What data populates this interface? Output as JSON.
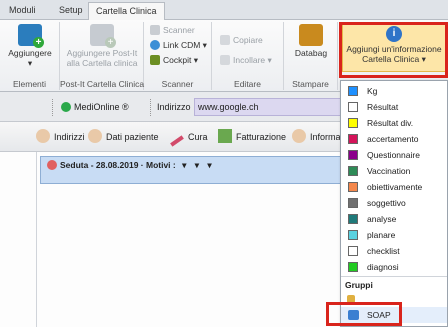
{
  "tabs": [
    "Moduli",
    "Setup",
    "Cartella Clinica"
  ],
  "ribbon": {
    "aggiungere_label": "Aggiungere",
    "aggiungere_postit_line1": "Aggiungere Post-It",
    "aggiungere_postit_line2": "alla Cartella clinica",
    "scanner": "Scanner",
    "link_cdm": "Link CDM",
    "cockpit": "Cockpit",
    "copiare": "Copiare",
    "incollare": "Incollare",
    "databag": "Databag",
    "aggiungi_info_line1": "Aggiungi un'informazione",
    "aggiungi_info_line2": "Cartella Clinica",
    "group_labels": [
      "Elementi",
      "Post-It Cartella Clinica",
      "Scanner",
      "Editare",
      "Stampare"
    ]
  },
  "address": {
    "medionline": "MediOnline ®",
    "label": "Indirizzo",
    "url": "www.google.ch"
  },
  "nav": [
    "Indirizzi",
    "Dati paziente",
    "Cura",
    "Fatturazione",
    "Informa"
  ],
  "seduta": {
    "text": "Seduta - 28.08.2019 · Motivi :"
  },
  "menu": {
    "items": [
      {
        "label": "Kg",
        "color": "#1e90ff"
      },
      {
        "label": "Résultat",
        "color": "#ffffff"
      },
      {
        "label": "Résultat div.",
        "color": "#ffff00"
      },
      {
        "label": "accertamento",
        "color": "#d4145a"
      },
      {
        "label": "Questionnaire",
        "color": "#8b008b"
      },
      {
        "label": "Vaccination",
        "color": "#2e8b57"
      },
      {
        "label": "obiettivamente",
        "color": "#f4874b"
      },
      {
        "label": "soggettivo",
        "color": "#707070"
      },
      {
        "label": "analyse",
        "color": "#1f7a7a"
      },
      {
        "label": "planare",
        "color": "#5ad1e0"
      },
      {
        "label": "checklist",
        "color": "#ffffff"
      },
      {
        "label": "diagnosi",
        "color": "#22cc22"
      }
    ],
    "gruppi_header": "Gruppi",
    "soap": "SOAP"
  }
}
